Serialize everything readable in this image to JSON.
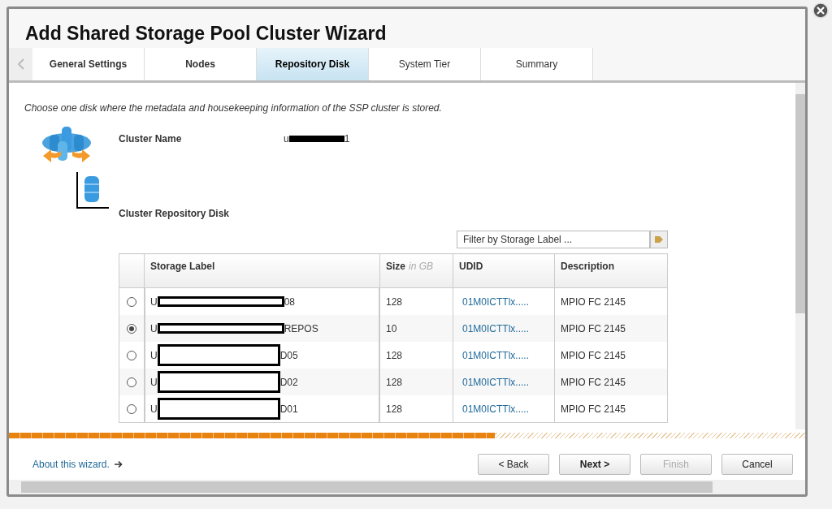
{
  "window": {
    "title": "Add Shared Storage Pool Cluster Wizard"
  },
  "tabs": [
    {
      "label": "General Settings",
      "selected": false,
      "done": true
    },
    {
      "label": "Nodes",
      "selected": false,
      "done": true
    },
    {
      "label": "Repository Disk",
      "selected": true,
      "done": true
    },
    {
      "label": "System Tier",
      "selected": false,
      "done": false
    },
    {
      "label": "Summary",
      "selected": false,
      "done": false
    }
  ],
  "instruction": "Choose one disk where the metadata and housekeeping information of the SSP cluster is stored.",
  "cluster_name": {
    "label": "Cluster Name",
    "value_start": "u",
    "value_end": "1"
  },
  "repository_label": "Cluster Repository Disk",
  "filter": {
    "placeholder": "Filter by Storage Label ..."
  },
  "table": {
    "columns": [
      {
        "label": "Storage Label"
      },
      {
        "label": "Size",
        "unit": "in GB"
      },
      {
        "label": "UDID"
      },
      {
        "label": "Description"
      }
    ],
    "rows": [
      {
        "selected": false,
        "label_start": "U",
        "label_end": "08",
        "size": "128",
        "udid": "01M0ICTTlx.....",
        "description": "MPIO FC 2145"
      },
      {
        "selected": true,
        "label_start": "U",
        "label_end": "REPOS",
        "size": "10",
        "udid": "01M0ICTTlx.....",
        "description": "MPIO FC 2145"
      },
      {
        "selected": false,
        "label_start": "U",
        "label_end": "D05",
        "size": "128",
        "udid": "01M0ICTTlx.....",
        "description": "MPIO FC 2145"
      },
      {
        "selected": false,
        "label_start": "U",
        "label_end": "D02",
        "size": "128",
        "udid": "01M0ICTTlx.....",
        "description": "MPIO FC 2145"
      },
      {
        "selected": false,
        "label_start": "U",
        "label_end": "D01",
        "size": "128",
        "udid": "01M0ICTTlx.....",
        "description": "MPIO FC 2145"
      }
    ]
  },
  "progress": {
    "level": 0.61
  },
  "about_link": "About this wizard.",
  "buttons": [
    {
      "label": "< Back",
      "kind": "normal",
      "disabled": false
    },
    {
      "label": "Next >",
      "kind": "primary",
      "disabled": false
    },
    {
      "label": "Finish",
      "kind": "normal",
      "disabled": true
    },
    {
      "label": "Cancel",
      "kind": "normal",
      "disabled": false
    }
  ]
}
